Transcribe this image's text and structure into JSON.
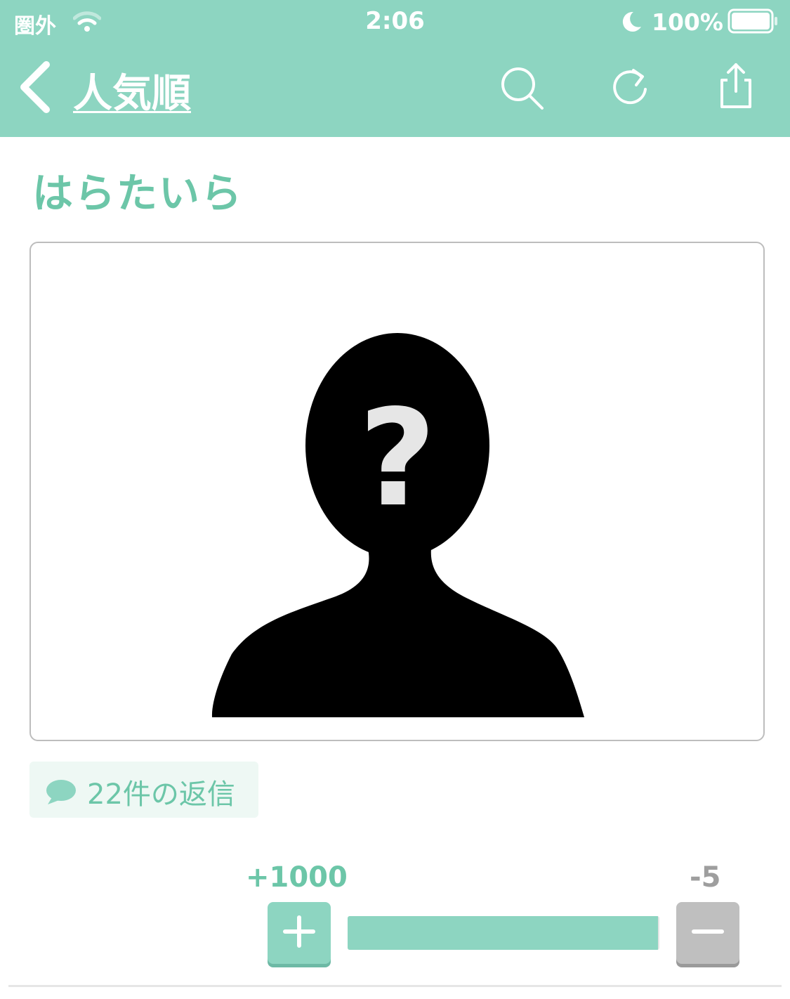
{
  "status_bar": {
    "carrier": "圏外",
    "time": "2:06",
    "battery": "100%"
  },
  "nav": {
    "back_title": "人気順",
    "icons": [
      "chevron-left-icon",
      "search-icon",
      "refresh-icon",
      "share-icon"
    ]
  },
  "post": {
    "title": "はらたいら",
    "image": "unknown-person-silhouette",
    "replies_label": "22件の返信"
  },
  "votes": {
    "plus_count": "+1000",
    "minus_count": "-5",
    "plus_share": 0.995
  },
  "colors": {
    "accent": "#8dd5c1",
    "accent_text": "#6cc6a8",
    "minus_gray": "#bfbfbf"
  }
}
